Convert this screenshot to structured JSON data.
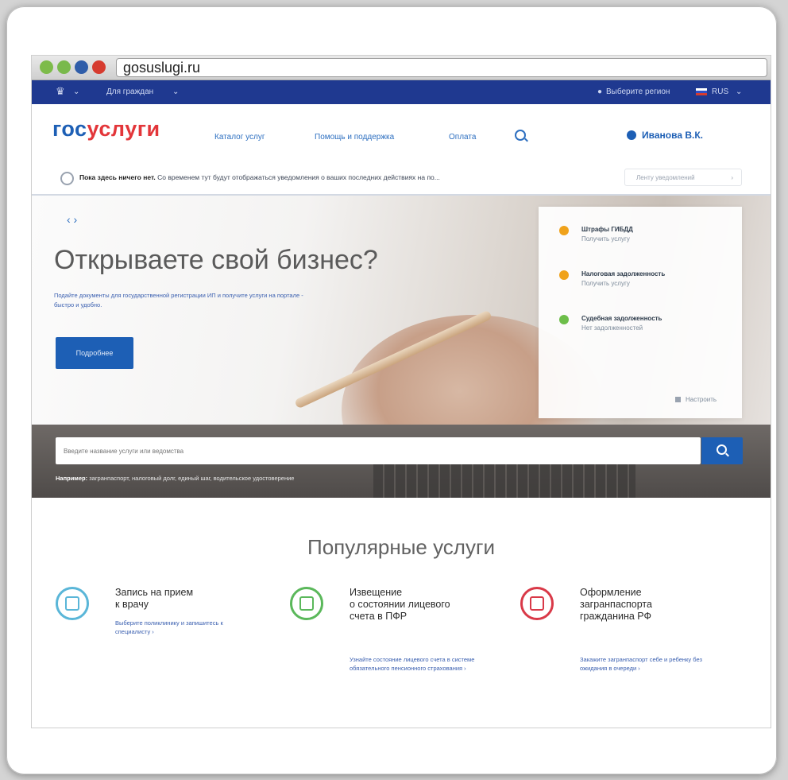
{
  "browser": {
    "url": "gosuslugi.ru"
  },
  "top_nav": {
    "audience": "Для граждан",
    "region": "Выберите регион",
    "language": "RUS"
  },
  "header": {
    "logo_a": "гос",
    "logo_b": "услуги",
    "links": [
      "Каталог услуг",
      "Помощь и поддержка",
      "Оплата"
    ],
    "user": "Иванова В.К."
  },
  "notification": {
    "bold": "Пока здесь ничего нет.",
    "text": "Со временем тут будут отображаться уведомления о ваших последних действиях на по...",
    "more": "Ленту уведомлений"
  },
  "hero": {
    "arrows": "‹  ›",
    "title": "Открываете свой бизнес?",
    "subtitle": "Подайте документы для государственной регистрации ИП и получите услуги на портале - быстро и удобно.",
    "button": "Подробнее",
    "panel": [
      {
        "title": "Штрафы ГИБДД",
        "action": "Получить услугу",
        "color": "#f0a21b"
      },
      {
        "title": "Налоговая задолженность",
        "action": "Получить услугу",
        "color": "#f0a21b"
      },
      {
        "title": "Судебная задолженность",
        "action": "Нет задолженностей",
        "color": "#6dbe4a"
      }
    ],
    "configure": "Настроить"
  },
  "search": {
    "placeholder": "Введите название услуги или ведомства",
    "hint_label": "Например:",
    "hint_text": "загранпаспорт, налоговый долг, единый шаг, водительское удостоверение"
  },
  "popular": {
    "title": "Популярные услуги",
    "items": [
      {
        "name": "Запись на прием\nк врачу",
        "desc": "Выберите поликлинику и запишитесь к специалисту  ›",
        "color": "#5ab6d8"
      },
      {
        "name": "Извещение\nо состоянии лицевого\nсчета в ПФР",
        "desc": "Узнайте состояние лицевого счета в системе обязательного пенсионного страхования  ›",
        "color": "#5bb85b"
      },
      {
        "name": "Оформление\nзагранпаспорта\nгражданина РФ",
        "desc": "Закажите загранпаспорт себе и ребенку без ожидания в очереди  ›",
        "color": "#d93948"
      }
    ]
  }
}
